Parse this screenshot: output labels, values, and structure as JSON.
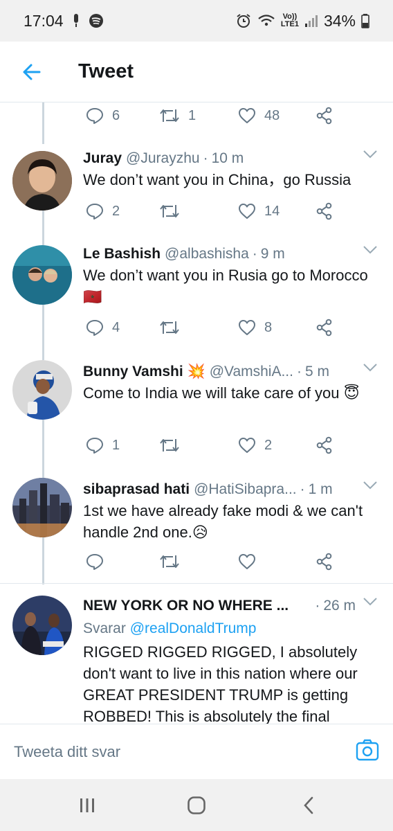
{
  "status": {
    "time": "17:04",
    "battery": "34%",
    "network": "LTE1",
    "volte": "Vo))",
    "icons": [
      "mic-icon",
      "spotify-icon",
      "alarm-icon",
      "wifi-icon",
      "signal-icon",
      "battery-icon"
    ]
  },
  "header": {
    "title": "Tweet"
  },
  "top_actions": {
    "replies": "6",
    "retweets": "1",
    "likes": "48"
  },
  "tweets": [
    {
      "name": "Juray",
      "handle": "@Jurayzhu",
      "time": "10 m",
      "text": "We don’t want you in China，go Russia",
      "replies": "2",
      "retweets": "",
      "likes": "14"
    },
    {
      "name": "Le Bashish",
      "handle": "@albashisha",
      "time": "9 m",
      "text": "We don’t want you in Rusia go to Morocco 🇲🇦",
      "replies": "4",
      "retweets": "",
      "likes": "8"
    },
    {
      "name": "Bunny Vamshi 💥",
      "handle": "@VamshiA...",
      "time": "5 m",
      "text": "Come to India we will take care of you 😇",
      "replies": "1",
      "retweets": "",
      "likes": "2"
    },
    {
      "name": "sibaprasad hati",
      "handle": "@HatiSibapra...",
      "time": "1 m",
      "text": "1st we have already fake modi & we can't handle 2nd one.😥",
      "replies": "",
      "retweets": "",
      "likes": ""
    },
    {
      "name": "NEW YORK OR NO WHERE ...",
      "handle": "",
      "time": "26 m",
      "reply_prefix": "Svarar",
      "reply_mention": "@realDonaldTrump",
      "text": "RIGGED RIGGED RIGGED, I absolutely don't want to live in this nation where our GREAT PRESIDENT TRUMP is getting ROBBED! This is absolutely the final"
    }
  ],
  "compose": {
    "placeholder": "Tweeta ditt svar"
  },
  "colors": {
    "accent": "#1da1f2",
    "muted": "#657786",
    "text": "#14171a",
    "divider": "#e1e8ed"
  }
}
